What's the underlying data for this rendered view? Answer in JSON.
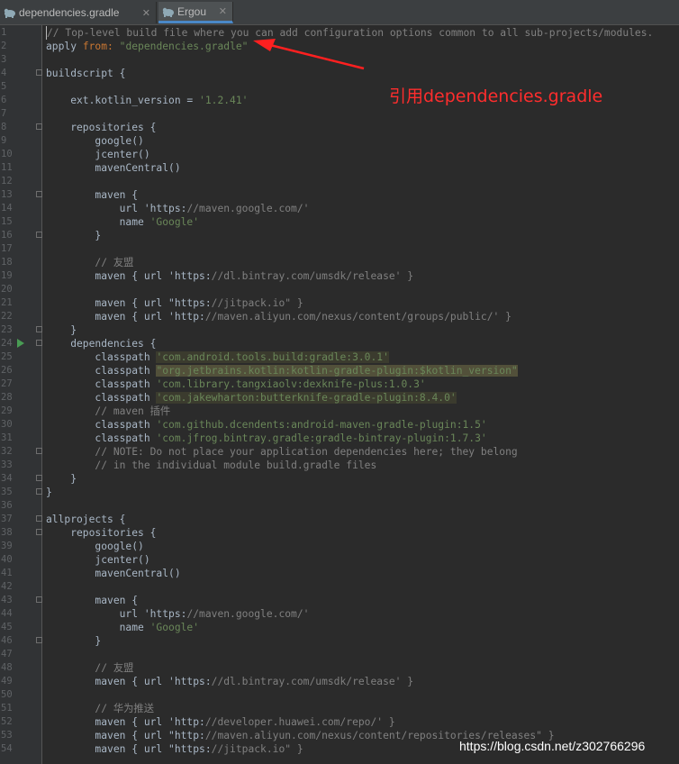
{
  "tabs": [
    {
      "label": "dependencies.gradle",
      "active": false
    },
    {
      "label": "Ergou",
      "active": true
    }
  ],
  "annotation": "引用dependencies.gradle",
  "watermark": "https://blog.csdn.net/z302766296",
  "colors": {
    "background": "#2b2b2b",
    "gutter": "#313335",
    "plain": "#a9b7c6",
    "string": "#6a8759",
    "keyword": "#cc7832",
    "comment": "#808080",
    "annotation": "#ff2d2d"
  },
  "lines": [
    {
      "n": "1",
      "t": "// Top-level build file where you can add configuration options common to all sub-projects/modules."
    },
    {
      "n": "2",
      "t": "apply from: \"dependencies.gradle\""
    },
    {
      "n": "3",
      "t": ""
    },
    {
      "n": "4",
      "t": "buildscript {"
    },
    {
      "n": "5",
      "t": ""
    },
    {
      "n": "6",
      "t": "    ext.kotlin_version = '1.2.41'"
    },
    {
      "n": "7",
      "t": ""
    },
    {
      "n": "8",
      "t": "    repositories {"
    },
    {
      "n": "9",
      "t": "        google()"
    },
    {
      "n": "10",
      "t": "        jcenter()"
    },
    {
      "n": "11",
      "t": "        mavenCentral()"
    },
    {
      "n": "12",
      "t": ""
    },
    {
      "n": "13",
      "t": "        maven {"
    },
    {
      "n": "14",
      "t": "            url 'https://maven.google.com/'"
    },
    {
      "n": "15",
      "t": "            name 'Google'"
    },
    {
      "n": "16",
      "t": "        }"
    },
    {
      "n": "17",
      "t": ""
    },
    {
      "n": "18",
      "t": "        // 友盟"
    },
    {
      "n": "19",
      "t": "        maven { url 'https://dl.bintray.com/umsdk/release' }"
    },
    {
      "n": "20",
      "t": ""
    },
    {
      "n": "21",
      "t": "        maven { url \"https://jitpack.io\" }"
    },
    {
      "n": "22",
      "t": "        maven { url 'http://maven.aliyun.com/nexus/content/groups/public/' }"
    },
    {
      "n": "23",
      "t": "    }"
    },
    {
      "n": "24",
      "t": "    dependencies {"
    },
    {
      "n": "25",
      "t": "        classpath 'com.android.tools.build:gradle:3.0.1'"
    },
    {
      "n": "26",
      "t": "        classpath \"org.jetbrains.kotlin:kotlin-gradle-plugin:$kotlin_version\""
    },
    {
      "n": "27",
      "t": "        classpath 'com.library.tangxiaolv:dexknife-plus:1.0.3'"
    },
    {
      "n": "28",
      "t": "        classpath 'com.jakewharton:butterknife-gradle-plugin:8.4.0'"
    },
    {
      "n": "29",
      "t": "        // maven 插件"
    },
    {
      "n": "30",
      "t": "        classpath 'com.github.dcendents:android-maven-gradle-plugin:1.5'"
    },
    {
      "n": "31",
      "t": "        classpath 'com.jfrog.bintray.gradle:gradle-bintray-plugin:1.7.3'"
    },
    {
      "n": "32",
      "t": "        // NOTE: Do not place your application dependencies here; they belong"
    },
    {
      "n": "33",
      "t": "        // in the individual module build.gradle files"
    },
    {
      "n": "34",
      "t": "    }"
    },
    {
      "n": "35",
      "t": "}"
    },
    {
      "n": "36",
      "t": ""
    },
    {
      "n": "37",
      "t": "allprojects {"
    },
    {
      "n": "38",
      "t": "    repositories {"
    },
    {
      "n": "39",
      "t": "        google()"
    },
    {
      "n": "40",
      "t": "        jcenter()"
    },
    {
      "n": "41",
      "t": "        mavenCentral()"
    },
    {
      "n": "42",
      "t": ""
    },
    {
      "n": "43",
      "t": "        maven {"
    },
    {
      "n": "44",
      "t": "            url 'https://maven.google.com/'"
    },
    {
      "n": "45",
      "t": "            name 'Google'"
    },
    {
      "n": "46",
      "t": "        }"
    },
    {
      "n": "47",
      "t": ""
    },
    {
      "n": "48",
      "t": "        // 友盟"
    },
    {
      "n": "49",
      "t": "        maven { url 'https://dl.bintray.com/umsdk/release' }"
    },
    {
      "n": "50",
      "t": ""
    },
    {
      "n": "51",
      "t": "        // 华为推送"
    },
    {
      "n": "52",
      "t": "        maven { url 'http://developer.huawei.com/repo/' }"
    },
    {
      "n": "53",
      "t": "        maven { url \"http://maven.aliyun.com/nexus/content/repositories/releases\" }"
    },
    {
      "n": "54",
      "t": "        maven { url \"https://jitpack.io\" }"
    }
  ]
}
